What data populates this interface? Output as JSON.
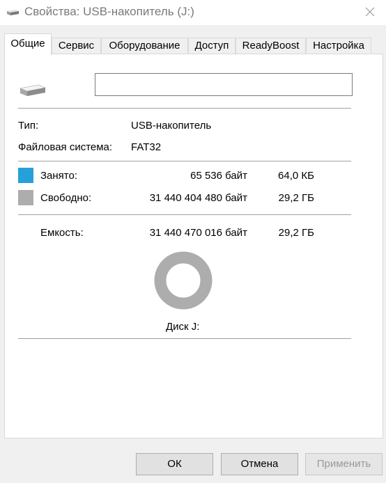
{
  "window": {
    "title": "Свойства: USB-накопитель (J:)",
    "title_icon": "usb-drive-icon",
    "close_icon": "close-icon"
  },
  "tabs": [
    {
      "label": "Общие",
      "active": true
    },
    {
      "label": "Сервис",
      "active": false
    },
    {
      "label": "Оборудование",
      "active": false
    },
    {
      "label": "Доступ",
      "active": false
    },
    {
      "label": "ReadyBoost",
      "active": false
    },
    {
      "label": "Настройка",
      "active": false
    }
  ],
  "general": {
    "drive_icon": "usb-drive-icon",
    "name_value": "",
    "type_label": "Тип:",
    "type_value": "USB-накопитель",
    "fs_label": "Файловая система:",
    "fs_value": "FAT32",
    "used": {
      "label": "Занято:",
      "bytes": "65 536 байт",
      "size": "64,0 КБ",
      "color": "#26a0da"
    },
    "free": {
      "label": "Свободно:",
      "bytes": "31 440 404 480 байт",
      "size": "29,2 ГБ",
      "color": "#adadad"
    },
    "capacity": {
      "label": "Емкость:",
      "bytes": "31 440 470 016 байт",
      "size": "29,2 ГБ"
    },
    "disk_label": "Диск J:",
    "used_fraction": 2.1e-06
  },
  "buttons": {
    "ok": "ОК",
    "cancel": "Отмена",
    "apply": "Применить"
  }
}
